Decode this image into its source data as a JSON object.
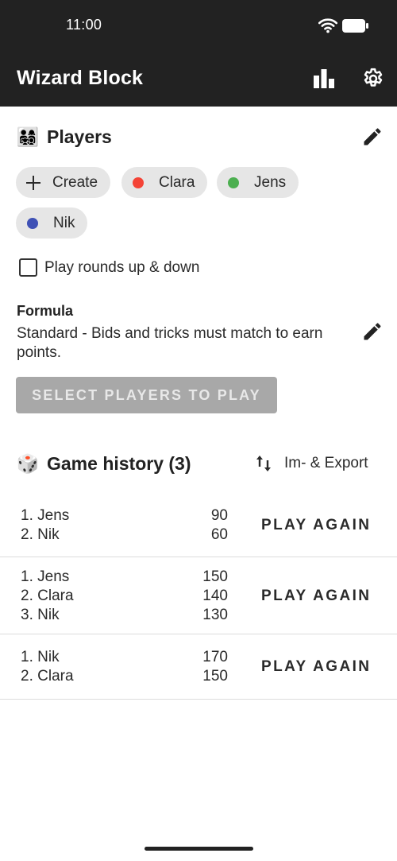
{
  "status": {
    "time": "11:00"
  },
  "appbar": {
    "title": "Wizard Block"
  },
  "players": {
    "title": "Players",
    "emoji": "👨‍👩‍👧‍👦",
    "create_label": "Create",
    "items": [
      {
        "name": "Clara",
        "color": "#f44336"
      },
      {
        "name": "Jens",
        "color": "#4caf50"
      },
      {
        "name": "Nik",
        "color": "#3f51b5"
      }
    ],
    "rounds_label": "Play rounds up & down"
  },
  "formula": {
    "label": "Formula",
    "description": "Standard - Bids and tricks must match to earn points."
  },
  "play_button_label": "SELECT PLAYERS TO PLAY",
  "history": {
    "title": "Game history (3)",
    "emoji": "🎲",
    "export_label": "Im- & Export",
    "play_again_label": "PLAY AGAIN",
    "games": [
      {
        "rows": [
          {
            "name": "1. Jens",
            "score": "90"
          },
          {
            "name": "2. Nik",
            "score": "60"
          }
        ]
      },
      {
        "rows": [
          {
            "name": "1. Jens",
            "score": "150"
          },
          {
            "name": "2. Clara",
            "score": "140"
          },
          {
            "name": "3. Nik",
            "score": "130"
          }
        ]
      },
      {
        "rows": [
          {
            "name": "1. Nik",
            "score": "170"
          },
          {
            "name": "2. Clara",
            "score": "150"
          }
        ]
      }
    ]
  }
}
